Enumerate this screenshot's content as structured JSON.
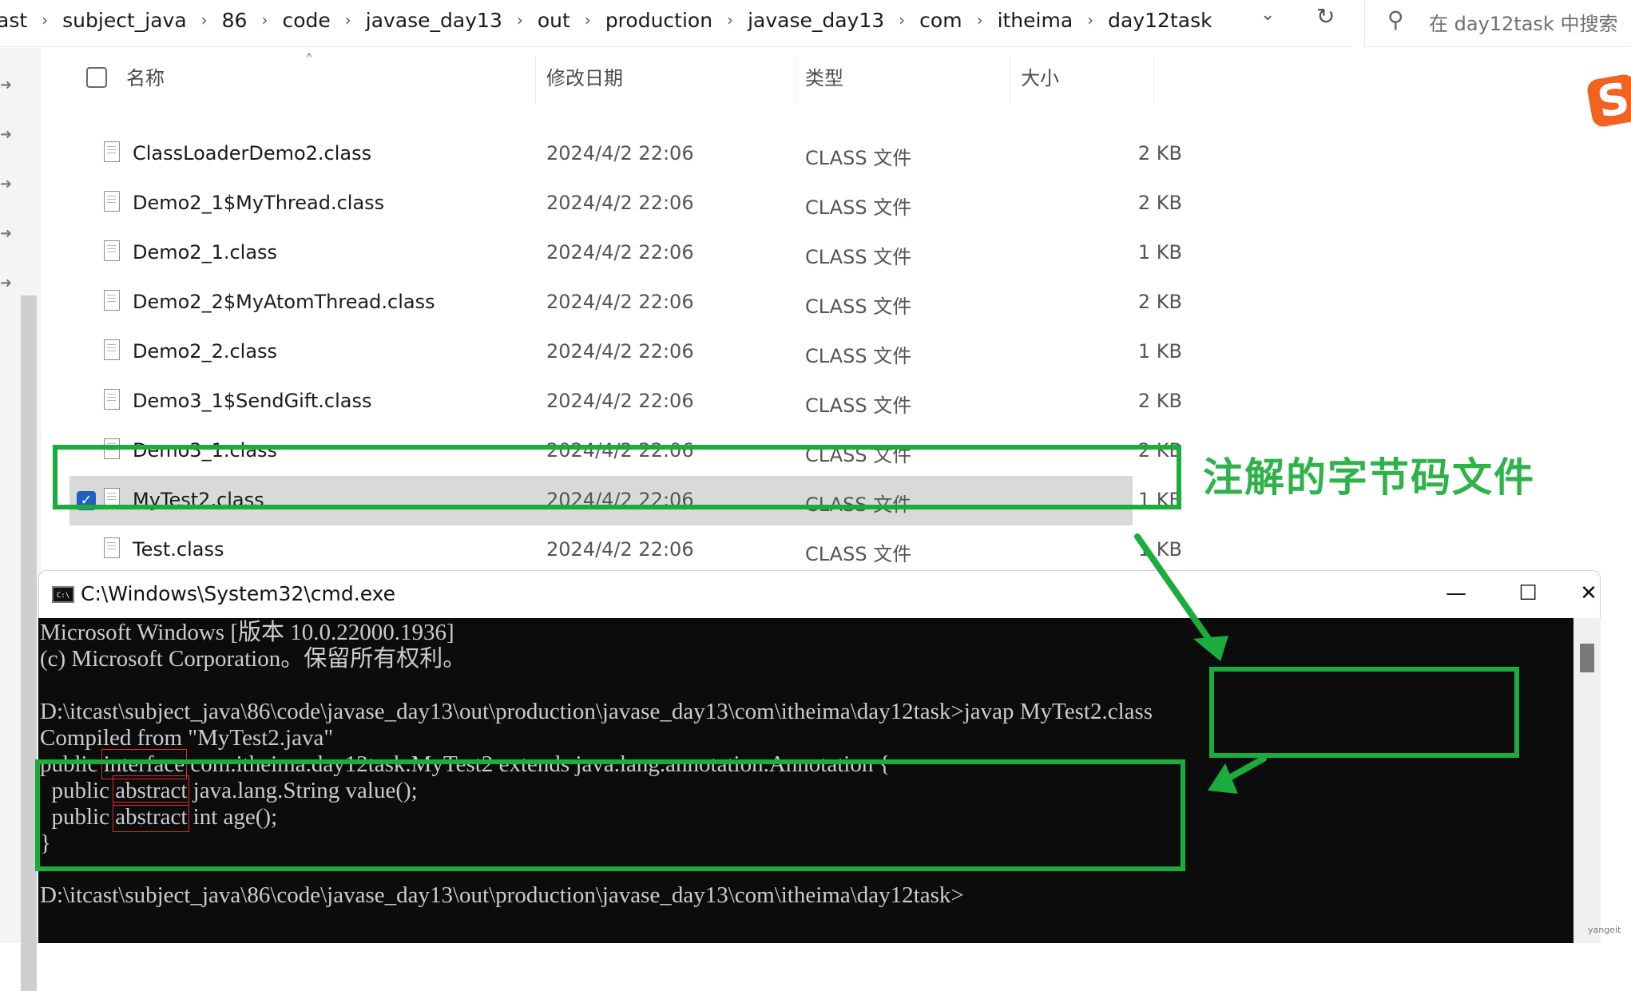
{
  "explorer": {
    "breadcrumbs": [
      "ast",
      "subject_java",
      "86",
      "code",
      "javase_day13",
      "out",
      "production",
      "javase_day13",
      "com",
      "itheima",
      "day12task"
    ],
    "search_placeholder": "在 day12task 中搜索",
    "columns": {
      "name": "名称",
      "modified": "修改日期",
      "type": "类型",
      "size": "大小"
    },
    "files": [
      {
        "name": "ClassLoaderDemo2.class",
        "modified": "2024/4/2 22:06",
        "type": "CLASS 文件",
        "size": "2 KB",
        "selected": false
      },
      {
        "name": "Demo2_1$MyThread.class",
        "modified": "2024/4/2 22:06",
        "type": "CLASS 文件",
        "size": "2 KB",
        "selected": false
      },
      {
        "name": "Demo2_1.class",
        "modified": "2024/4/2 22:06",
        "type": "CLASS 文件",
        "size": "1 KB",
        "selected": false
      },
      {
        "name": "Demo2_2$MyAtomThread.class",
        "modified": "2024/4/2 22:06",
        "type": "CLASS 文件",
        "size": "2 KB",
        "selected": false
      },
      {
        "name": "Demo2_2.class",
        "modified": "2024/4/2 22:06",
        "type": "CLASS 文件",
        "size": "1 KB",
        "selected": false
      },
      {
        "name": "Demo3_1$SendGift.class",
        "modified": "2024/4/2 22:06",
        "type": "CLASS 文件",
        "size": "2 KB",
        "selected": false
      },
      {
        "name": "Demo3_1.class",
        "modified": "2024/4/2 22:06",
        "type": "CLASS 文件",
        "size": "2 KB",
        "selected": false
      },
      {
        "name": "MyTest2.class",
        "modified": "2024/4/2 22:06",
        "type": "CLASS 文件",
        "size": "1 KB",
        "selected": true
      },
      {
        "name": "Test.class",
        "modified": "2024/4/2 22:06",
        "type": "CLASS 文件",
        "size": "1 KB",
        "selected": false
      }
    ]
  },
  "annotation": {
    "label": "注解的字节码文件",
    "color": "#1aac3c"
  },
  "cmd": {
    "title": "C:\\Windows\\System32\\cmd.exe",
    "lines": {
      "l1": "Microsoft Windows [版本 10.0.22000.1936]",
      "l2": "(c) Microsoft Corporation。保留所有权利。",
      "l3": "D:\\itcast\\subject_java\\86\\code\\javase_day13\\out\\production\\javase_day13\\com\\itheima\\day12task>javap MyTest2.class",
      "l4": "Compiled from \"MyTest2.java\"",
      "l5_a": "public ",
      "l5_b": "interface",
      "l5_c": " com.itheima.day12task.MyTest2 extends java.lang.annotation.Annotation {",
      "l6_a": "  public ",
      "l6_b": "abstract",
      "l6_c": " java.lang.String value();",
      "l7_a": "  public ",
      "l7_b": "abstract",
      "l7_c": " int age();",
      "l8": "}",
      "l9": "D:\\itcast\\subject_java\\86\\code\\javase_day13\\out\\production\\javase_day13\\com\\itheima\\day12task>"
    }
  },
  "icons": {
    "dropdown": "chevron-down-icon",
    "refresh": "refresh-icon",
    "search": "search-icon",
    "file": "file-icon",
    "minimize": "minimize-icon",
    "maximize": "maximize-icon",
    "close": "close-icon"
  },
  "ime_logo": "S",
  "watermark": "yangeit"
}
